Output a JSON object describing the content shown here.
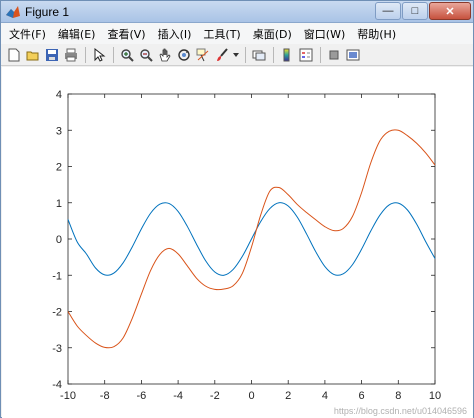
{
  "window": {
    "title": "Figure 1",
    "controls": {
      "minimize": "—",
      "maximize": "□",
      "close": "✕"
    }
  },
  "menu": [
    "文件(F)",
    "编辑(E)",
    "查看(V)",
    "插入(I)",
    "工具(T)",
    "桌面(D)",
    "窗口(W)",
    "帮助(H)"
  ],
  "toolbar": {
    "icons": [
      "new-figure-icon",
      "open-file-icon",
      "save-icon",
      "print-icon",
      "|",
      "pointer-icon",
      "|",
      "zoom-in-icon",
      "zoom-out-icon",
      "pan-hand-icon",
      "rotate-3d-icon",
      "data-cursor-icon",
      "brush-icon",
      "brush-dropdown-icon",
      "|",
      "link-plot-icon",
      "|",
      "colorbar-icon",
      "legend-icon",
      "|",
      "hide-plot-tools-icon",
      "show-plot-tools-icon"
    ]
  },
  "colors": {
    "series1": "#0072bd",
    "series2": "#d95319",
    "axis": "#262626"
  },
  "watermark": "https://blog.csdn.net/u014046596",
  "chart_data": {
    "type": "line",
    "title": "",
    "xlabel": "",
    "ylabel": "",
    "xlim": [
      -10,
      10
    ],
    "ylim": [
      -4,
      4
    ],
    "xticks": [
      -10,
      -8,
      -6,
      -4,
      -2,
      0,
      2,
      4,
      6,
      8,
      10
    ],
    "yticks": [
      -4,
      -3,
      -2,
      -1,
      0,
      1,
      2,
      3,
      4
    ],
    "grid": false,
    "box": true,
    "series": [
      {
        "color": "#0072bd",
        "x": [
          -10,
          -9.5,
          -9,
          -8.5,
          -8,
          -7.5,
          -7,
          -6.5,
          -6,
          -5.5,
          -5,
          -4.5,
          -4,
          -3.5,
          -3,
          -2.5,
          -2,
          -1.5,
          -1,
          -0.5,
          0,
          0.5,
          1,
          1.5,
          2,
          2.5,
          3,
          3.5,
          4,
          4.5,
          5,
          5.5,
          6,
          6.5,
          7,
          7.5,
          8,
          8.5,
          9,
          9.5,
          10
        ],
        "y": [
          0.54,
          -0.08,
          -0.41,
          -0.8,
          -0.99,
          -0.94,
          -0.66,
          -0.22,
          0.28,
          0.71,
          0.96,
          0.98,
          0.76,
          0.35,
          -0.14,
          -0.6,
          -0.91,
          -1.0,
          -0.84,
          -0.48,
          0.0,
          0.48,
          0.84,
          1.0,
          0.91,
          0.6,
          0.14,
          -0.35,
          -0.76,
          -0.98,
          -0.96,
          -0.71,
          -0.28,
          0.22,
          0.66,
          0.94,
          0.99,
          0.8,
          0.41,
          -0.08,
          -0.54
        ]
      },
      {
        "color": "#d95319",
        "x": [
          -10,
          -9.5,
          -9,
          -8.5,
          -8,
          -7.5,
          -7,
          -6.5,
          -6,
          -5.5,
          -5,
          -4.5,
          -4,
          -3.5,
          -3,
          -2.5,
          -2,
          -1.5,
          -1,
          -0.5,
          0,
          0.5,
          1,
          1.5,
          2,
          2.5,
          3,
          3.5,
          4,
          4.5,
          5,
          5.5,
          6,
          6.5,
          7,
          7.5,
          8,
          8.5,
          9,
          9.5,
          10
        ],
        "y": [
          -2.0,
          -2.4,
          -2.66,
          -2.87,
          -2.99,
          -2.97,
          -2.73,
          -2.19,
          -1.52,
          -0.87,
          -0.43,
          -0.26,
          -0.41,
          -0.74,
          -1.08,
          -1.3,
          -1.39,
          -1.38,
          -1.29,
          -0.95,
          -0.22,
          0.66,
          1.32,
          1.42,
          1.22,
          0.95,
          0.73,
          0.53,
          0.34,
          0.23,
          0.29,
          0.62,
          1.28,
          2.1,
          2.71,
          2.97,
          3.0,
          2.85,
          2.64,
          2.37,
          2.04
        ]
      }
    ]
  }
}
